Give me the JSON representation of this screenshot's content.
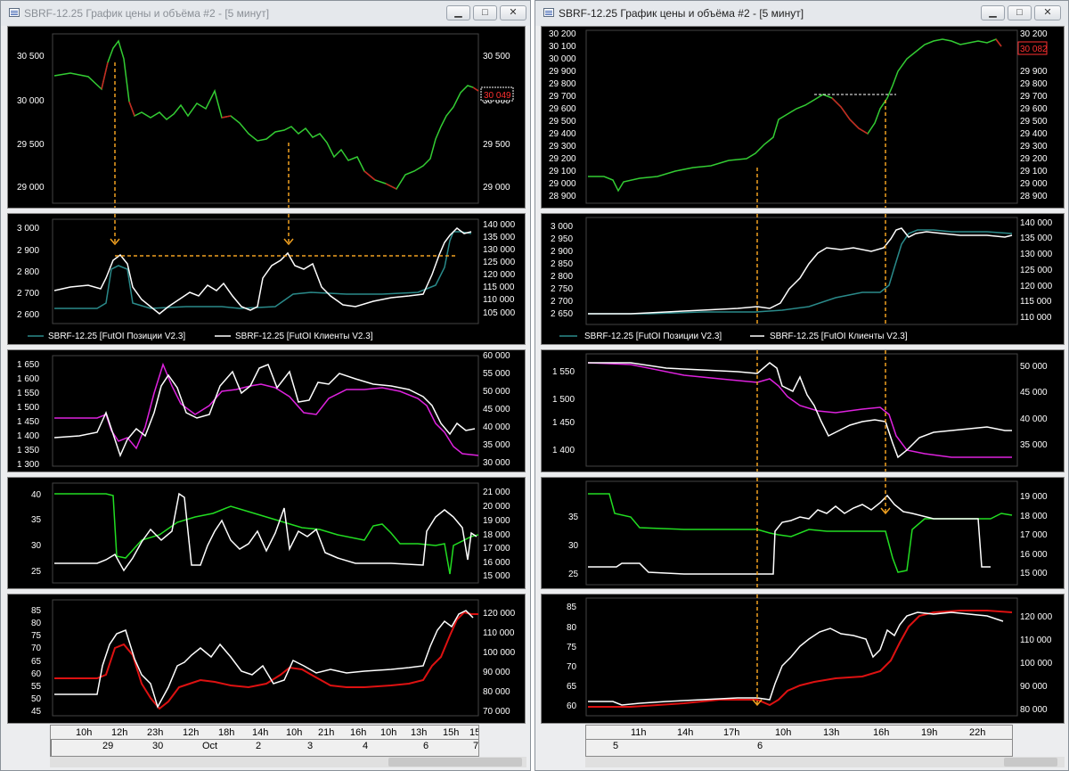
{
  "left": {
    "title": "SBRF-12.25 График цены и объёма #2 - [5 минут]",
    "buttons": {
      "minimize": "▁",
      "maximize": "□",
      "close": "✕"
    },
    "price": {
      "ticks_right": [
        "30 500",
        "30 000",
        "29 500",
        "29 000"
      ],
      "ticks_left": [
        "30 500",
        "30 000",
        "29 500",
        "29 000"
      ],
      "last": "30 049"
    },
    "oi": {
      "ticks_left": [
        "3 000",
        "2 900",
        "2 800",
        "2 700",
        "2 600"
      ],
      "ticks_right": [
        "140 000",
        "135 000",
        "130 000",
        "125 000",
        "120 000",
        "115 000",
        "110 000",
        "105 000"
      ],
      "legend1": "SBRF-12.25 [FutOI Позиции V2.3]",
      "legend2": "SBRF-12.25 [FutOI Клиенты V2.3]"
    },
    "p3": {
      "ticks_left": [
        "1 650",
        "1 600",
        "1 550",
        "1 500",
        "1 450",
        "1 400",
        "1 350",
        "1 300"
      ],
      "ticks_right": [
        "60 000",
        "55 000",
        "50 000",
        "45 000",
        "40 000",
        "35 000",
        "30 000"
      ]
    },
    "p4": {
      "ticks_left": [
        "40",
        "35",
        "30",
        "25"
      ],
      "ticks_right": [
        "21 000",
        "20 000",
        "19 000",
        "18 000",
        "17 000",
        "16 000",
        "15 000"
      ]
    },
    "p5": {
      "ticks_left": [
        "85",
        "80",
        "75",
        "70",
        "65",
        "60",
        "55",
        "50",
        "45"
      ],
      "ticks_right": [
        "120 000",
        "110 000",
        "100 000",
        "90 000",
        "80 000",
        "70 000"
      ]
    },
    "time_row1": [
      "10h",
      "12h",
      "23h",
      "12h",
      "18h",
      "14h",
      "10h",
      "21h",
      "16h",
      "10h",
      "13h",
      "15h",
      "15h"
    ],
    "time_row2": [
      "29",
      "30",
      "Oct",
      "2",
      "3",
      "4",
      "6",
      "7"
    ]
  },
  "right": {
    "title": "SBRF-12.25 График цены и объёма #2 - [5 минут]",
    "buttons": {
      "minimize": "▁",
      "maximize": "□",
      "close": "✕"
    },
    "price": {
      "ticks": [
        "30 200",
        "30 100",
        "30 000",
        "29 900",
        "29 800",
        "29 700",
        "29 600",
        "29 500",
        "29 400",
        "29 300",
        "29 200",
        "29 100",
        "29 000",
        "28 900"
      ],
      "last": "30 082"
    },
    "oi": {
      "ticks_left": [
        "3 000",
        "2 950",
        "2 900",
        "2 850",
        "2 800",
        "2 750",
        "2 700",
        "2 650"
      ],
      "ticks_right": [
        "140 000",
        "135 000",
        "130 000",
        "125 000",
        "120 000",
        "115 000",
        "110 000"
      ],
      "legend1": "SBRF-12.25 [FutOI Позиции V2.3]",
      "legend2": "SBRF-12.25 [FutOI Клиенты V2.3]"
    },
    "p3": {
      "ticks_left": [
        "1 550",
        "1 500",
        "1 450",
        "1 400"
      ],
      "ticks_right": [
        "50 000",
        "45 000",
        "40 000",
        "35 000"
      ]
    },
    "p4": {
      "ticks_left": [
        "35",
        "30",
        "25"
      ],
      "ticks_right": [
        "19 000",
        "18 000",
        "17 000",
        "16 000",
        "15 000"
      ]
    },
    "p5": {
      "ticks_left": [
        "85",
        "80",
        "75",
        "70",
        "65",
        "60"
      ],
      "ticks_right": [
        "120 000",
        "110 000",
        "100 000",
        "90 000",
        "80 000"
      ]
    },
    "time_row1": [
      "11h",
      "14h",
      "17h",
      "10h",
      "13h",
      "16h",
      "19h",
      "22h"
    ],
    "time_row2": [
      "5",
      "6"
    ]
  },
  "colors": {
    "price_up": "#33cc33",
    "price_down": "#cc2222",
    "teal": "#2a8a8a",
    "white": "#ffffff",
    "magenta": "#dd22dd",
    "green": "#22dd22",
    "red": "#dd1111",
    "annotation": "#f0a020"
  }
}
